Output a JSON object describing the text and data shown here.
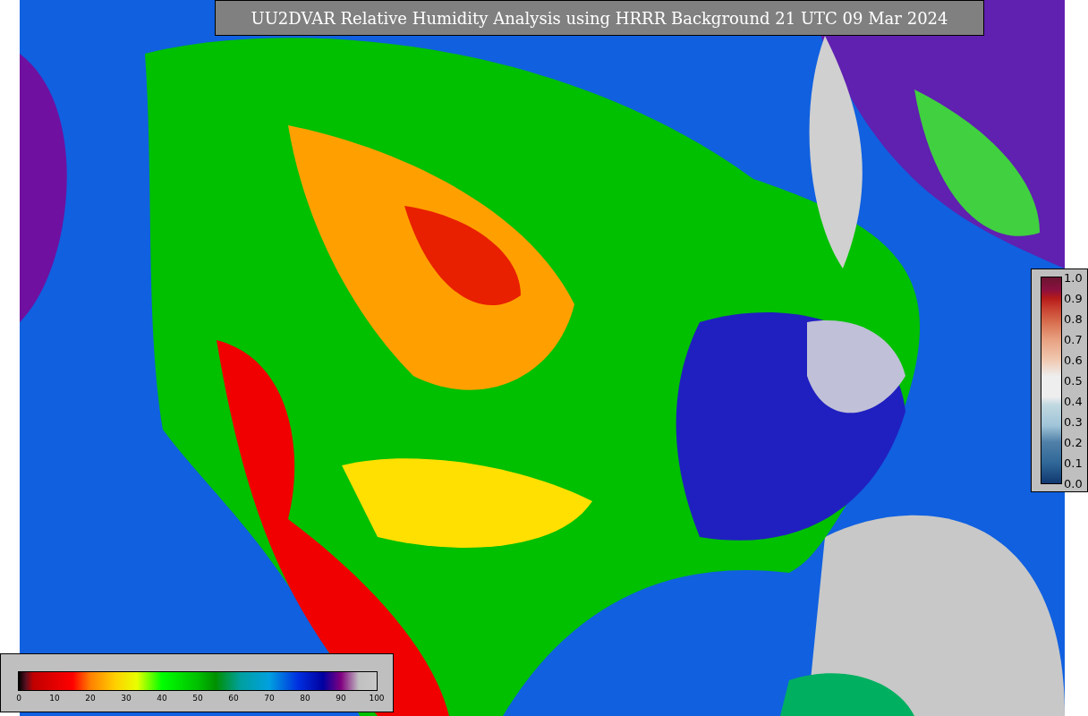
{
  "title": "UU2DVAR Relative Humidity Analysis using HRRR Background 21 UTC 09 Mar 2024",
  "humidity_colorbar": {
    "ticks": [
      "0",
      "10",
      "20",
      "30",
      "40",
      "50",
      "60",
      "70",
      "80",
      "90",
      "100"
    ]
  },
  "station_colorbar": {
    "ticks": [
      "1.0",
      "0.9",
      "0.8",
      "0.7",
      "0.6",
      "0.5",
      "0.4",
      "0.3",
      "0.2",
      "0.1",
      "0.0"
    ]
  }
}
